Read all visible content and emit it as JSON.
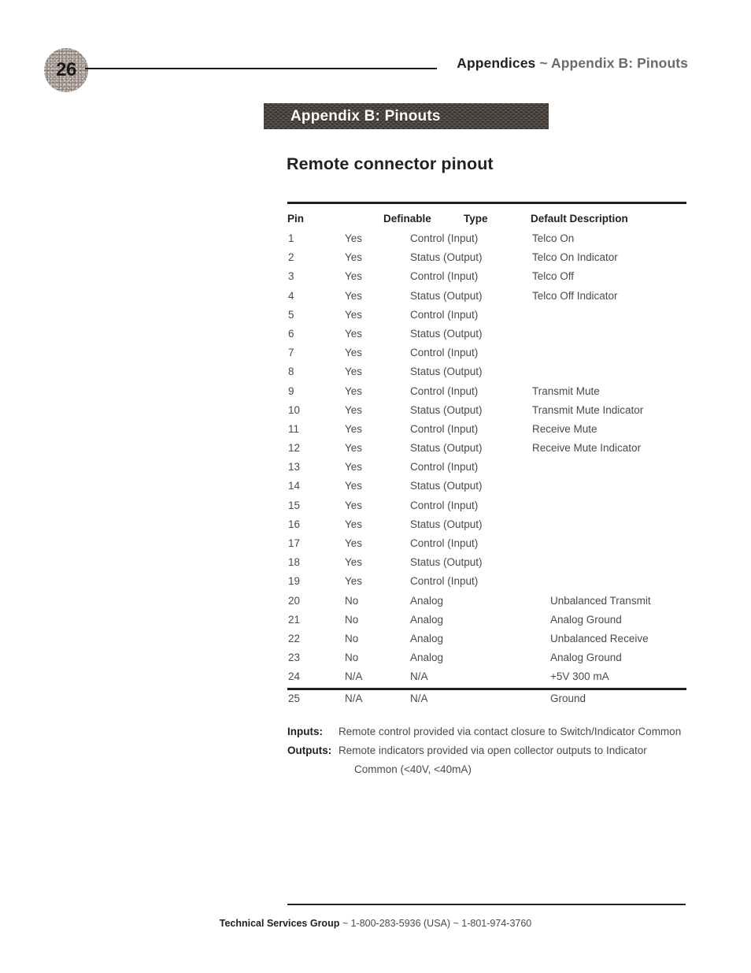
{
  "page": {
    "number": "26",
    "running_head": {
      "primary": "Appendices",
      "separator": " ~ ",
      "secondary": "Appendix B: Pinouts"
    }
  },
  "banner": {
    "title": "Appendix B: Pinouts"
  },
  "section": {
    "title": "Remote connector pinout"
  },
  "table": {
    "headers": {
      "pin": "Pin",
      "definable": "Definable",
      "type": "Type",
      "description": "Default Description"
    },
    "rows": [
      {
        "pin": "1",
        "definable": "Yes",
        "type": "Control (Input)",
        "description": "Telco On"
      },
      {
        "pin": "2",
        "definable": "Yes",
        "type": "Status (Output)",
        "description": "Telco On Indicator"
      },
      {
        "pin": "3",
        "definable": "Yes",
        "type": "Control (Input)",
        "description": "Telco Off"
      },
      {
        "pin": "4",
        "definable": "Yes",
        "type": "Status (Output)",
        "description": "Telco Off Indicator"
      },
      {
        "pin": "5",
        "definable": "Yes",
        "type": "Control (Input)",
        "description": ""
      },
      {
        "pin": "6",
        "definable": "Yes",
        "type": "Status (Output)",
        "description": ""
      },
      {
        "pin": "7",
        "definable": "Yes",
        "type": "Control (Input)",
        "description": ""
      },
      {
        "pin": "8",
        "definable": "Yes",
        "type": "Status (Output)",
        "description": ""
      },
      {
        "pin": "9",
        "definable": "Yes",
        "type": "Control (Input)",
        "description": "Transmit Mute"
      },
      {
        "pin": "10",
        "definable": "Yes",
        "type": "Status (Output)",
        "description": "Transmit Mute Indicator"
      },
      {
        "pin": "11",
        "definable": "Yes",
        "type": "Control (Input)",
        "description": "Receive Mute"
      },
      {
        "pin": "12",
        "definable": "Yes",
        "type": "Status (Output)",
        "description": "Receive Mute Indicator"
      },
      {
        "pin": "13",
        "definable": "Yes",
        "type": "Control (Input)",
        "description": ""
      },
      {
        "pin": "14",
        "definable": "Yes",
        "type": "Status (Output)",
        "description": ""
      },
      {
        "pin": "15",
        "definable": "Yes",
        "type": "Control (Input)",
        "description": ""
      },
      {
        "pin": "16",
        "definable": "Yes",
        "type": "Status (Output)",
        "description": ""
      },
      {
        "pin": "17",
        "definable": "Yes",
        "type": "Control (Input)",
        "description": ""
      },
      {
        "pin": "18",
        "definable": "Yes",
        "type": "Status (Output)",
        "description": ""
      },
      {
        "pin": "19",
        "definable": "Yes",
        "type": "Control (Input)",
        "description": ""
      },
      {
        "pin": "20",
        "definable": "No",
        "type": "Analog",
        "description": "Unbalanced Transmit"
      },
      {
        "pin": "21",
        "definable": "No",
        "type": "Analog",
        "description": "Analog Ground"
      },
      {
        "pin": "22",
        "definable": "No",
        "type": "Analog",
        "description": "Unbalanced Receive"
      },
      {
        "pin": "23",
        "definable": "No",
        "type": "Analog",
        "description": "Analog Ground"
      },
      {
        "pin": "24",
        "definable": "N/A",
        "type": "N/A",
        "description": "+5V 300 mA"
      },
      {
        "pin": "25",
        "definable": "N/A",
        "type": "N/A",
        "description": "Ground"
      }
    ]
  },
  "notes": {
    "inputs_label": "Inputs:",
    "inputs_text": "Remote control provided via contact closure to Switch/Indicator Common",
    "outputs_label": "Outputs:",
    "outputs_text": "Remote indicators provided via open collector outputs to Indicator",
    "outputs_text_cont": "Common (<40V, <40mA)"
  },
  "footer": {
    "org": "Technical Services Group",
    "contact": " ~ 1-800-283-5936 (USA) ~ 1-801-974-3760"
  }
}
